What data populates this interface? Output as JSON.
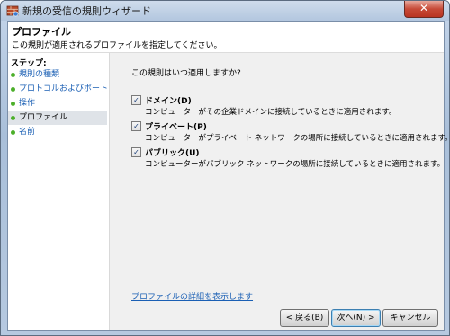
{
  "window": {
    "title": "新規の受信の規則ウィザード",
    "close_glyph": "✕"
  },
  "header": {
    "title": "プロファイル",
    "description": "この規則が適用されるプロファイルを指定してください。"
  },
  "steps": {
    "label": "ステップ:",
    "items": [
      {
        "label": "規則の種類",
        "state": "link"
      },
      {
        "label": "プロトコルおよびポート",
        "state": "link"
      },
      {
        "label": "操作",
        "state": "link"
      },
      {
        "label": "プロファイル",
        "state": "current"
      },
      {
        "label": "名前",
        "state": "link"
      }
    ],
    "bullet_color": "#4caf2a"
  },
  "content": {
    "question": "この規則はいつ適用しますか?",
    "options": [
      {
        "label": "ドメイン(D)",
        "description": "コンピューターがその企業ドメインに接続しているときに適用されます。",
        "checked": true
      },
      {
        "label": "プライベート(P)",
        "description": "コンピューターがプライベート ネットワークの場所に接続しているときに適用されます。",
        "checked": true
      },
      {
        "label": "パブリック(U)",
        "description": "コンピューターがパブリック ネットワークの場所に接続しているときに適用されます。",
        "checked": true
      }
    ],
    "check_glyph": "✓",
    "details_link": "プロファイルの詳細を表示します"
  },
  "buttons": {
    "back": "< 戻る(B)",
    "next": "次へ(N) >",
    "cancel": "キャンセル"
  }
}
